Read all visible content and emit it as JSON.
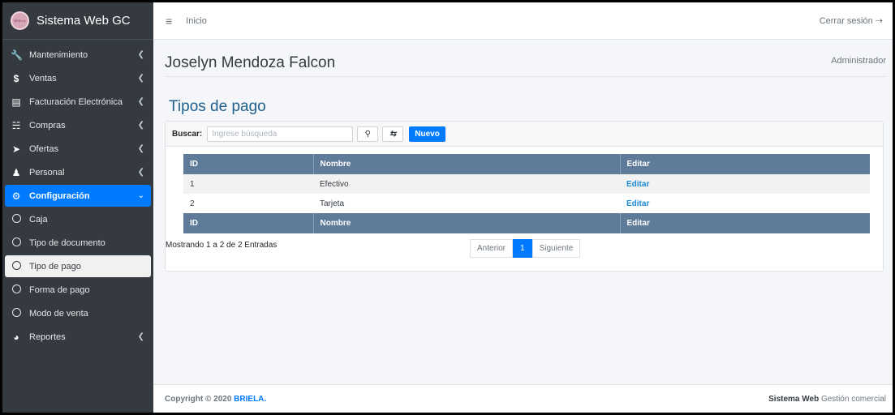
{
  "brand": {
    "title": "Sistema Web GC",
    "logo_text": "BRIELA"
  },
  "sidebar": {
    "items": [
      {
        "label": "Mantenimiento",
        "icon": "wrench-icon"
      },
      {
        "label": "Ventas",
        "icon": "dollar-icon"
      },
      {
        "label": "Facturación Electrónica",
        "icon": "invoice-icon"
      },
      {
        "label": "Compras",
        "icon": "cart-icon"
      },
      {
        "label": "Ofertas",
        "icon": "tag-icon"
      },
      {
        "label": "Personal",
        "icon": "users-icon"
      },
      {
        "label": "Configuración",
        "icon": "gear-icon"
      },
      {
        "label": "Caja",
        "icon": "circle-icon"
      },
      {
        "label": "Tipo de documento",
        "icon": "circle-icon"
      },
      {
        "label": "Tipo de pago",
        "icon": "circle-icon"
      },
      {
        "label": "Forma de pago",
        "icon": "circle-icon"
      },
      {
        "label": "Modo de venta",
        "icon": "circle-icon"
      },
      {
        "label": "Reportes",
        "icon": "pie-chart-icon"
      }
    ]
  },
  "topbar": {
    "home": "Inicio",
    "logout": "Cerrar sesión"
  },
  "header": {
    "user": "Joselyn Mendoza Falcon",
    "role": "Administrador"
  },
  "page": {
    "title": "Tipos de pago"
  },
  "toolbar": {
    "search_label": "Buscar:",
    "search_placeholder": "Ingrese búsqueda",
    "search_value": "",
    "new_label": "Nuevo"
  },
  "table": {
    "headers": [
      "ID",
      "Nombre",
      "Editar"
    ],
    "rows": [
      {
        "id": "1",
        "name": "Efectivo",
        "action": "Editar"
      },
      {
        "id": "2",
        "name": "Tarjeta",
        "action": "Editar"
      }
    ]
  },
  "pagination": {
    "info": "Mostrando 1 a 2 de 2 Entradas",
    "prev": "Anterior",
    "current": "1",
    "next": "Siguiente"
  },
  "footer": {
    "copyright": "Copyright © 2020",
    "company": "BRIELA.",
    "app_bold": "Sistema Web",
    "app_rest": "Gestión comercial"
  },
  "colors": {
    "sidebar": "#343a40",
    "accent": "#007bff",
    "table_header": "#5f7b9a",
    "title": "#1f5f8b"
  }
}
